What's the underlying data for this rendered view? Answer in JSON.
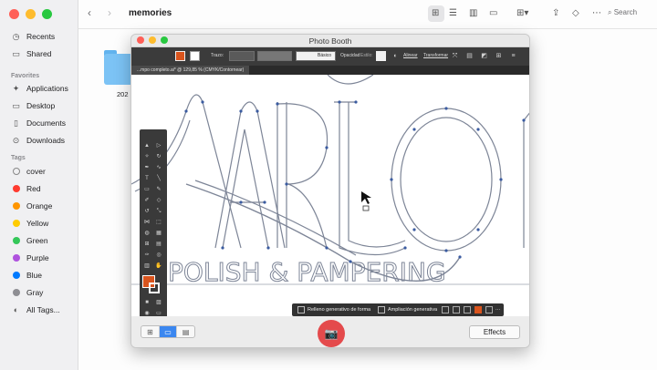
{
  "finder": {
    "title": "memories",
    "search_label": "Search",
    "folder_label": "202",
    "sidebar": {
      "items_top": [
        {
          "label": "Recents",
          "icon": "clock-icon"
        },
        {
          "label": "Shared",
          "icon": "shared-folder-icon"
        }
      ],
      "favorites_header": "Favorites",
      "favorites": [
        {
          "label": "Applications",
          "icon": "applications-icon"
        },
        {
          "label": "Desktop",
          "icon": "desktop-icon"
        },
        {
          "label": "Documents",
          "icon": "document-icon"
        },
        {
          "label": "Downloads",
          "icon": "download-icon"
        }
      ],
      "tags_header": "Tags",
      "tags": [
        {
          "label": "cover",
          "color": "outline"
        },
        {
          "label": "Red",
          "color": "#ff3b30"
        },
        {
          "label": "Orange",
          "color": "#ff9500"
        },
        {
          "label": "Yellow",
          "color": "#ffcc00"
        },
        {
          "label": "Green",
          "color": "#34c759"
        },
        {
          "label": "Purple",
          "color": "#af52de"
        },
        {
          "label": "Blue",
          "color": "#007aff"
        },
        {
          "label": "Gray",
          "color": "#8e8e93"
        }
      ],
      "all_tags": "All Tags..."
    }
  },
  "photobooth": {
    "title": "Photo Booth",
    "effects_label": "Effects",
    "accent": "#e44a4c"
  },
  "illustrator": {
    "control": {
      "stroke_label": "Trazo:",
      "basic_label": "Básico",
      "opacity_label": "Opacidad",
      "style_label": "Estilo:",
      "align_label": "Alinear",
      "transform_label": "Transformar"
    },
    "doc_tab": "...mpo completo.ai* @ 129,85 % (CMYK/Contornear)",
    "context_bar": {
      "fill_label": "Relleno generativo de forma",
      "expand_label": "Ampliación generativa"
    },
    "fill_color": "#d9541d",
    "artwork_text_line1": "ARLO",
    "artwork_text_line2": "POLISH & PAMPERING"
  }
}
